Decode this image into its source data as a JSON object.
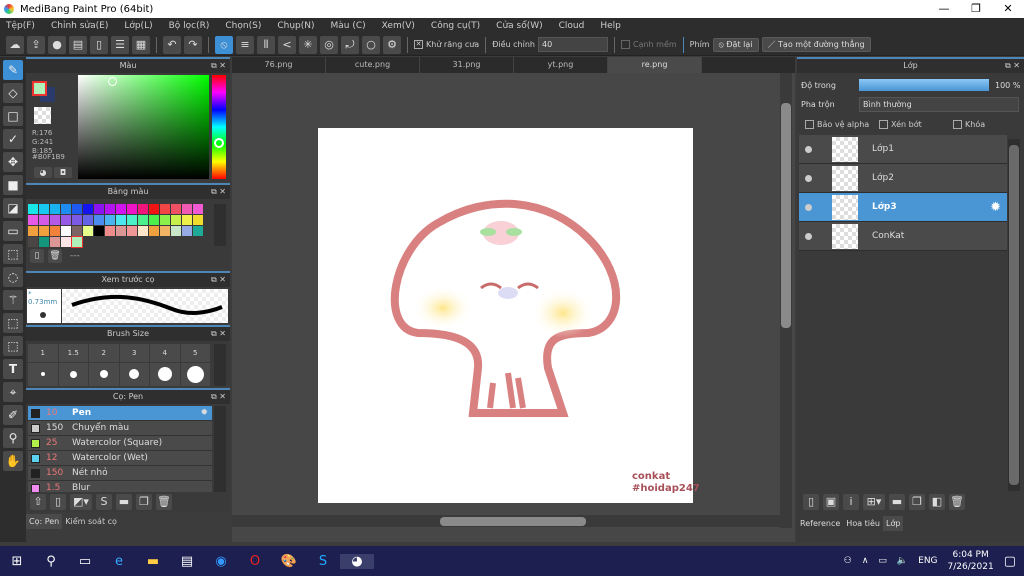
{
  "window": {
    "title": "MediBang Paint Pro (64bit)",
    "min": "—",
    "max": "❐",
    "close": "✕"
  },
  "menu": [
    "Tệp(F)",
    "Chỉnh sửa(E)",
    "Lớp(L)",
    "Bộ lọc(R)",
    "Chọn(S)",
    "Chụp(N)",
    "Màu (C)",
    "Xem(V)",
    "Công cụ(T)",
    "Cửa sổ(W)",
    "Cloud",
    "Help"
  ],
  "toolbar": {
    "antialias_label": "Khử răng cưa",
    "antialias_checked": true,
    "adjust_label": "Điều chỉnh",
    "adjust_value": "40",
    "soft_edge_label": "Cạnh mềm",
    "key_label": "Phím",
    "reset_label": "Đặt lại",
    "straight_line_label": "Tạo một đường thẳng"
  },
  "color_panel": {
    "title": "Màu",
    "r": "R:176",
    "g": "G:241",
    "b": "B:185",
    "hex": "#B0F1B9",
    "fg": "#b0f1b9",
    "bg": "#2a3a6a"
  },
  "palette_panel": {
    "title": "Bảng màu",
    "footer": "---",
    "colors": [
      "#19e6e6",
      "#19c8f0",
      "#19b4f0",
      "#1e8cf0",
      "#1e5af0",
      "#1414f0",
      "#8c14f0",
      "#b414f0",
      "#d214f0",
      "#f014c8",
      "#f0147d",
      "#f01414",
      "#f04646",
      "#f05064",
      "#f05ab4",
      "#f05ad2",
      "#e65ae6",
      "#d25ae6",
      "#b45ae6",
      "#965ae6",
      "#7d5ae6",
      "#6464e6",
      "#4b8cf0",
      "#4bb4f0",
      "#4be6f0",
      "#4bf0c8",
      "#4bf08c",
      "#4bf04b",
      "#8cf04b",
      "#c8f04b",
      "#f0f04b",
      "#f0dc2d",
      "#f0a03c",
      "#f0a03c",
      "#f0823c",
      "#ffffff",
      "#7d6464",
      "#e6ff8c",
      "#000000",
      "#f08c8c",
      "#dc9696",
      "#f09696",
      "#ffe6c8",
      "#f0a03c",
      "#f0b464",
      "#c8e6c8",
      "#96aae6",
      "#1eaa96",
      "#4b4646",
      "#14967d",
      "#dc9696",
      "#ffe6e6",
      "#b0f1b9"
    ]
  },
  "brush_preview": {
    "title": "Xem trước cọ",
    "size": "* 0.73mm"
  },
  "brush_size": {
    "title": "Brush Size",
    "sizes": [
      "1",
      "1.5",
      "2",
      "3",
      "4",
      "5"
    ]
  },
  "brush_panel": {
    "title": "Cọ: Pen",
    "items": [
      {
        "size": "10",
        "name": "Pen",
        "color": "#222222",
        "selected": true
      },
      {
        "size": "150",
        "name": "Chuyển màu",
        "color": "#cccccc"
      },
      {
        "size": "25",
        "name": "Watercolor (Square)",
        "color": "#b4f04b"
      },
      {
        "size": "12",
        "name": "Watercolor (Wet)",
        "color": "#5ad2f0"
      },
      {
        "size": "150",
        "name": "Nét nhỏ",
        "color": "#222222"
      },
      {
        "size": "1.5",
        "name": "Blur",
        "color": "#f08cf0"
      }
    ]
  },
  "left_tabs": [
    "Cọ: Pen",
    "Kiểm soát cọ"
  ],
  "doc_tabs": [
    "76.png",
    "cute.png",
    "31.png",
    "yt.png",
    "re.png"
  ],
  "active_doc": 4,
  "canvas": {
    "watermark_line1": "conkat",
    "watermark_line2": "#hoidap247"
  },
  "layer_panel": {
    "title": "Lớp",
    "opacity_label": "Độ trong",
    "opacity_value": "100 %",
    "opacity": 100,
    "blend_label": "Pha trộn",
    "blend_value": "Bình thường",
    "protect_alpha": "Bảo vệ alpha",
    "clipping": "Xén bớt",
    "lock": "Khóa",
    "layers": [
      {
        "name": "Lớp1"
      },
      {
        "name": "Lớp2"
      },
      {
        "name": "Lớp3",
        "selected": true
      },
      {
        "name": "ConKat"
      }
    ]
  },
  "right_tabs": [
    "Reference",
    "Hoa tiêu",
    "Lớp"
  ],
  "taskbar": {
    "lang": "ENG",
    "time": "6:04 PM",
    "date": "7/26/2021"
  },
  "accent": "#4a95d4"
}
